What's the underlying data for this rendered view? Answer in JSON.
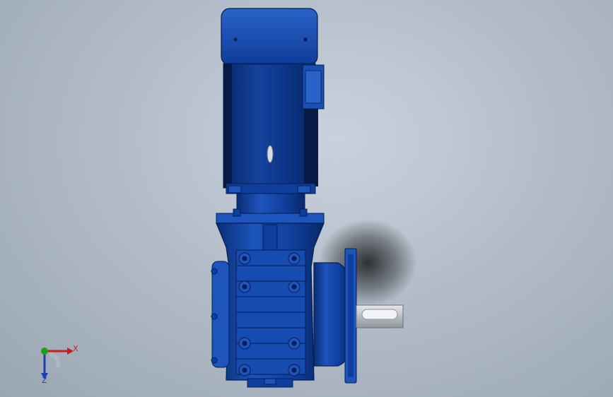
{
  "viewport": {
    "background_top": "#c9d2dc",
    "background_bottom": "#9aa6b3"
  },
  "model": {
    "body_color": "#0f3f9e",
    "body_dark": "#0a2d75",
    "body_light": "#2a63c8",
    "shaft_color": "#c9ccd0",
    "shadow_color": "#000000"
  },
  "triad": {
    "x_label": "X",
    "z_label": "Z",
    "x_color": "#c81e1e",
    "y_color": "#1ea01e",
    "z_color": "#1e3fb0"
  }
}
